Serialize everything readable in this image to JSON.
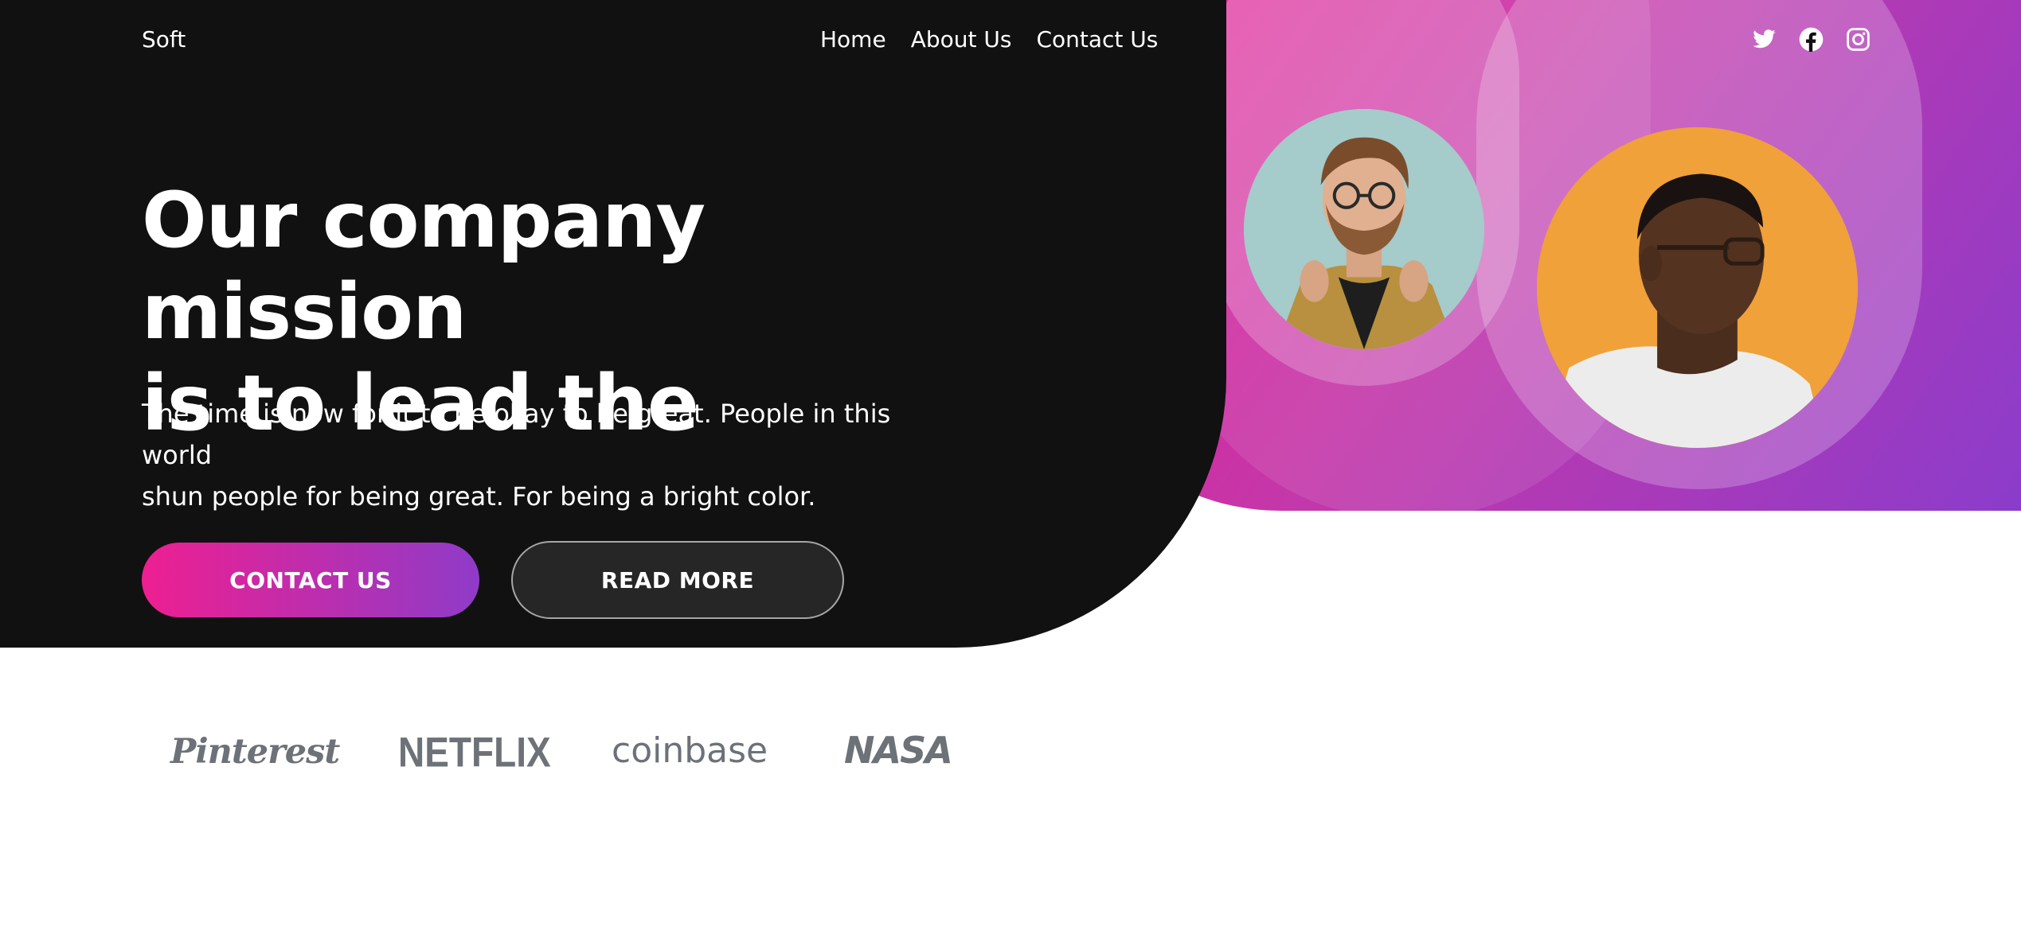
{
  "header": {
    "brand": "Soft",
    "nav": [
      {
        "label": "Home"
      },
      {
        "label": "About Us"
      },
      {
        "label": "Contact Us"
      }
    ],
    "social": [
      {
        "icon": "twitter-icon"
      },
      {
        "icon": "facebook-icon"
      },
      {
        "icon": "instagram-icon"
      }
    ]
  },
  "hero": {
    "title_line1": "Our company mission",
    "title_line2": "is to lead the",
    "subtext_line1": "The time is now for it to be okay to be great. People in this world",
    "subtext_line2": "shun people for being great. For being a bright color.",
    "contact_button": "CONTACT US",
    "read_more_button": "READ MORE"
  },
  "logos": [
    "Pinterest",
    "NETFLIX",
    "coinbase",
    "NASA"
  ],
  "colors": {
    "hero_dark": "#111111",
    "gradient_start": "#ea1a8e",
    "gradient_end": "#8b3ccb",
    "logo_gray": "#6d7178",
    "portrait_1_bg": "#a5cbcb",
    "portrait_2_bg": "#f0a13a"
  }
}
